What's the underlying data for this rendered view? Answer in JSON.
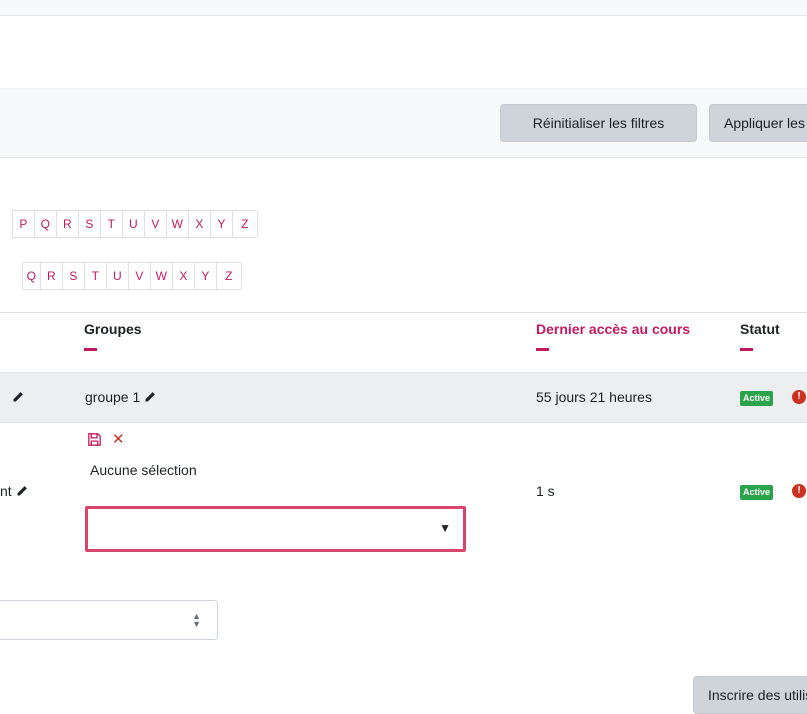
{
  "filters": {
    "reset_label": "Réinitialiser les filtres",
    "apply_label": "Appliquer les filtres"
  },
  "initials_first": [
    "P",
    "Q",
    "R",
    "S",
    "T",
    "U",
    "V",
    "W",
    "X",
    "Y",
    "Z"
  ],
  "initials_last": [
    "Q",
    "R",
    "S",
    "T",
    "U",
    "V",
    "W",
    "X",
    "Y",
    "Z"
  ],
  "table": {
    "headers": {
      "groups": "Groupes",
      "last_access": "Dernier accès au cours",
      "status": "Statut"
    },
    "rows": [
      {
        "group": "groupe 1",
        "last_access": "55 jours 21 heures",
        "status": "Active"
      },
      {
        "role_suffix": "nt",
        "group_selection": "Aucune sélection",
        "last_access": "1 s",
        "status": "Active"
      }
    ]
  },
  "enrol_label": "Inscrire des utilisateurs",
  "colors": {
    "accent": "#c4195f",
    "active_badge": "#2aa34a",
    "danger": "#ca3120",
    "focus_border": "#d8456d"
  },
  "icons": {
    "edit": "pencil-icon",
    "save": "floppy-disk-icon",
    "cancel": "times-icon",
    "info": "exclamation-circle-icon",
    "dropdown": "caret-down-icon"
  }
}
